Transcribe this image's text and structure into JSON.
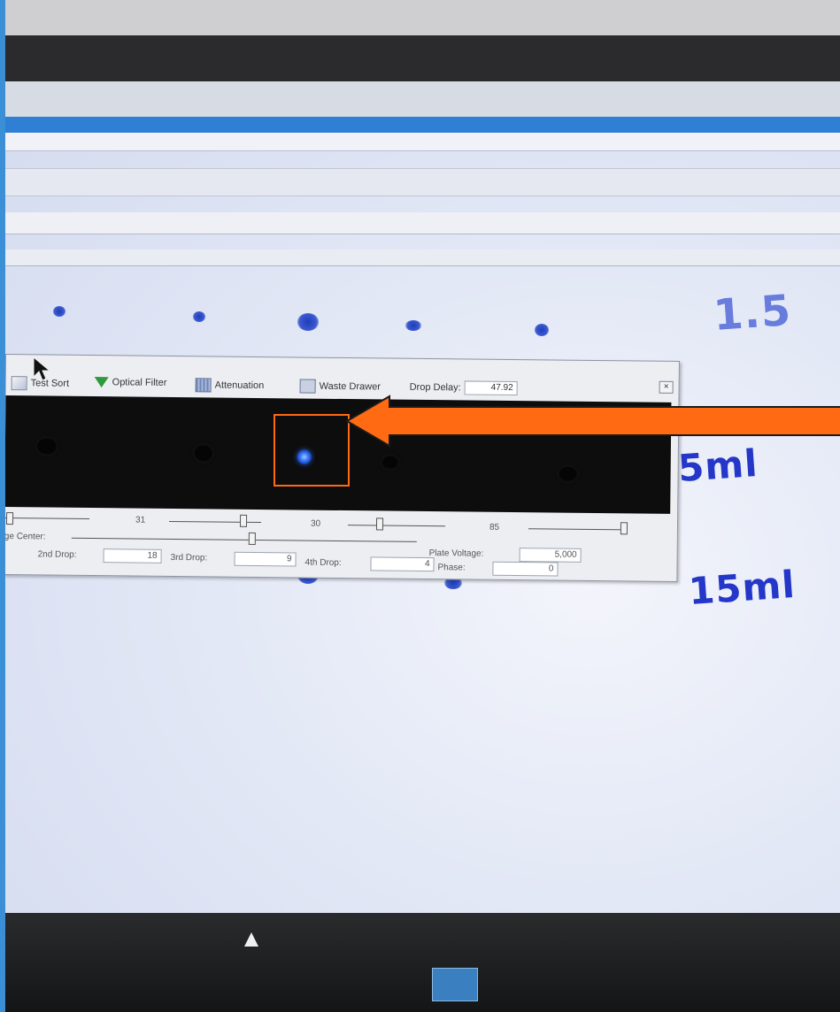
{
  "toolbar": {
    "test_sort": "Test Sort",
    "optical_filter": "Optical Filter",
    "attenuation": "Attenuation",
    "waste_drawer": "Waste Drawer",
    "drop_delay_label": "Drop Delay:",
    "drop_delay_value": "47.92"
  },
  "sliders": {
    "value_1": "31",
    "value_2": "30",
    "value_3": "85",
    "image_center_label": "ge Center:",
    "plate_voltage_label": "Plate Voltage:",
    "plate_voltage_value": "5,000"
  },
  "drops": {
    "second_label": "2nd Drop:",
    "second_value": "18",
    "third_label": "3rd Drop:",
    "third_value": "9",
    "fourth_label": "4th Drop:",
    "fourth_value": "4",
    "phase_label": "Phase:",
    "phase_value": "0"
  },
  "handwriting": {
    "row1": "1.5",
    "row2": "5ml",
    "row3": "15ml"
  },
  "colors": {
    "annotation": "#ff6a13",
    "ink": "#2437c9",
    "bright_drop": "#2e6ef2"
  }
}
